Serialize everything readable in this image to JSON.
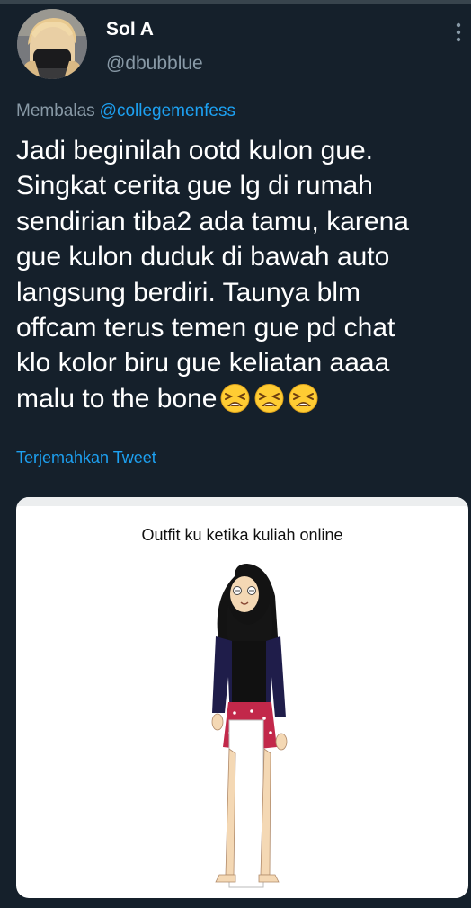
{
  "tweet": {
    "display_name": "Sol A",
    "handle": "@dbubblue",
    "replying_prefix": "Membalas",
    "replying_to": "@collegemenfess",
    "text_lines": [
      "Jadi beginilah ootd kulon gue.",
      "Singkat cerita gue lg di rumah",
      "sendirian tiba2 ada tamu, karena",
      "gue kulon duduk di bawah auto",
      "langsung berdiri. Taunya blm",
      "offcam terus temen gue pd chat",
      "klo kolor biru gue keliatan aaaa",
      "malu to the bone"
    ],
    "emoji": [
      "😫",
      "😫",
      "😫"
    ],
    "translate_label": "Terjemahkan Tweet",
    "media": {
      "caption": "Outfit ku ketika kuliah online"
    }
  },
  "colors": {
    "background": "#15202b",
    "primary_text": "#ffffff",
    "secondary_text": "#8899a6",
    "accent": "#1da1f2"
  },
  "icons": {
    "more": "more-vertical-icon",
    "emoji": "tired-face-emoji"
  }
}
